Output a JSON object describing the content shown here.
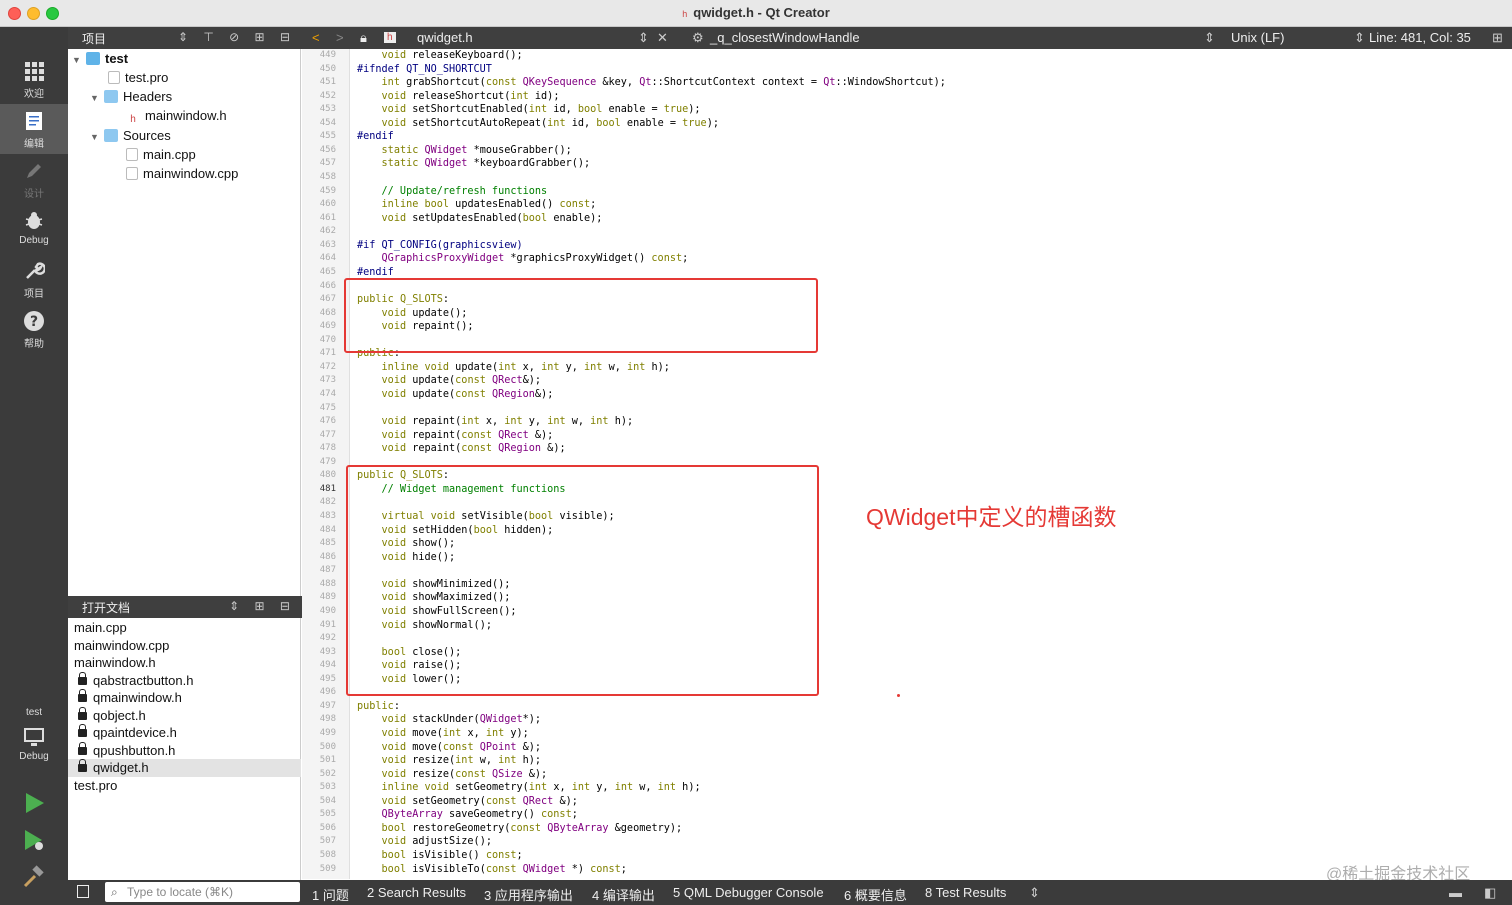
{
  "window": {
    "title": "qwidget.h - Qt Creator"
  },
  "modes": [
    {
      "label": "欢迎",
      "icon": "grid-icon"
    },
    {
      "label": "编辑",
      "icon": "edit-icon"
    },
    {
      "label": "设计",
      "icon": "pen-icon"
    },
    {
      "label": "Debug",
      "icon": "bug-icon"
    },
    {
      "label": "项目",
      "icon": "wrench-icon"
    },
    {
      "label": "帮助",
      "icon": "help-icon"
    }
  ],
  "kit": {
    "project": "test",
    "config": "Debug"
  },
  "project_pane": {
    "title": "项目",
    "tree": [
      {
        "label": "test",
        "level": 0,
        "bold": true
      },
      {
        "label": "test.pro",
        "level": 1
      },
      {
        "label": "Headers",
        "level": 1
      },
      {
        "label": "mainwindow.h",
        "level": 2
      },
      {
        "label": "Sources",
        "level": 1
      },
      {
        "label": "main.cpp",
        "level": 2
      },
      {
        "label": "mainwindow.cpp",
        "level": 2
      }
    ]
  },
  "open_docs": {
    "title": "打开文档",
    "items": [
      {
        "label": "main.cpp",
        "locked": false
      },
      {
        "label": "mainwindow.cpp",
        "locked": false
      },
      {
        "label": "mainwindow.h",
        "locked": false
      },
      {
        "label": "qabstractbutton.h",
        "locked": true
      },
      {
        "label": "qmainwindow.h",
        "locked": true
      },
      {
        "label": "qobject.h",
        "locked": true
      },
      {
        "label": "qpaintdevice.h",
        "locked": true
      },
      {
        "label": "qpushbutton.h",
        "locked": true
      },
      {
        "label": "qwidget.h",
        "locked": true
      },
      {
        "label": "test.pro",
        "locked": false
      }
    ]
  },
  "editor_toolbar": {
    "file": "qwidget.h",
    "symbol": "_q_closestWindowHandle",
    "line_ending": "Unix (LF)",
    "position": "Line: 481, Col: 35"
  },
  "editor": {
    "current_line": "481",
    "lines": [
      {
        "n": "449",
        "c": "    void releaseKeyboard();"
      },
      {
        "n": "450",
        "c": "#ifndef QT_NO_SHORTCUT"
      },
      {
        "n": "451",
        "c": "    int grabShortcut(const QKeySequence &key, Qt::ShortcutContext context = Qt::WindowShortcut);"
      },
      {
        "n": "452",
        "c": "    void releaseShortcut(int id);"
      },
      {
        "n": "453",
        "c": "    void setShortcutEnabled(int id, bool enable = true);"
      },
      {
        "n": "454",
        "c": "    void setShortcutAutoRepeat(int id, bool enable = true);"
      },
      {
        "n": "455",
        "c": "#endif"
      },
      {
        "n": "456",
        "c": "    static QWidget *mouseGrabber();"
      },
      {
        "n": "457",
        "c": "    static QWidget *keyboardGrabber();"
      },
      {
        "n": "458",
        "c": ""
      },
      {
        "n": "459",
        "c": "    // Update/refresh functions"
      },
      {
        "n": "460",
        "c": "    inline bool updatesEnabled() const;"
      },
      {
        "n": "461",
        "c": "    void setUpdatesEnabled(bool enable);"
      },
      {
        "n": "462",
        "c": ""
      },
      {
        "n": "463",
        "c": "#if QT_CONFIG(graphicsview)"
      },
      {
        "n": "464",
        "c": "    QGraphicsProxyWidget *graphicsProxyWidget() const;"
      },
      {
        "n": "465",
        "c": "#endif"
      },
      {
        "n": "466",
        "c": ""
      },
      {
        "n": "467",
        "c": "public Q_SLOTS:"
      },
      {
        "n": "468",
        "c": "    void update();"
      },
      {
        "n": "469",
        "c": "    void repaint();"
      },
      {
        "n": "470",
        "c": ""
      },
      {
        "n": "471",
        "c": "public:"
      },
      {
        "n": "472",
        "c": "    inline void update(int x, int y, int w, int h);"
      },
      {
        "n": "473",
        "c": "    void update(const QRect&);"
      },
      {
        "n": "474",
        "c": "    void update(const QRegion&);"
      },
      {
        "n": "475",
        "c": ""
      },
      {
        "n": "476",
        "c": "    void repaint(int x, int y, int w, int h);"
      },
      {
        "n": "477",
        "c": "    void repaint(const QRect &);"
      },
      {
        "n": "478",
        "c": "    void repaint(const QRegion &);"
      },
      {
        "n": "479",
        "c": ""
      },
      {
        "n": "480",
        "c": "public Q_SLOTS:"
      },
      {
        "n": "481",
        "c": "    // Widget management functions"
      },
      {
        "n": "482",
        "c": ""
      },
      {
        "n": "483",
        "c": "    virtual void setVisible(bool visible);"
      },
      {
        "n": "484",
        "c": "    void setHidden(bool hidden);"
      },
      {
        "n": "485",
        "c": "    void show();"
      },
      {
        "n": "486",
        "c": "    void hide();"
      },
      {
        "n": "487",
        "c": ""
      },
      {
        "n": "488",
        "c": "    void showMinimized();"
      },
      {
        "n": "489",
        "c": "    void showMaximized();"
      },
      {
        "n": "490",
        "c": "    void showFullScreen();"
      },
      {
        "n": "491",
        "c": "    void showNormal();"
      },
      {
        "n": "492",
        "c": ""
      },
      {
        "n": "493",
        "c": "    bool close();"
      },
      {
        "n": "494",
        "c": "    void raise();"
      },
      {
        "n": "495",
        "c": "    void lower();"
      },
      {
        "n": "496",
        "c": ""
      },
      {
        "n": "497",
        "c": "public:"
      },
      {
        "n": "498",
        "c": "    void stackUnder(QWidget*);"
      },
      {
        "n": "499",
        "c": "    void move(int x, int y);"
      },
      {
        "n": "500",
        "c": "    void move(const QPoint &);"
      },
      {
        "n": "501",
        "c": "    void resize(int w, int h);"
      },
      {
        "n": "502",
        "c": "    void resize(const QSize &);"
      },
      {
        "n": "503",
        "c": "    inline void setGeometry(int x, int y, int w, int h);"
      },
      {
        "n": "504",
        "c": "    void setGeometry(const QRect &);"
      },
      {
        "n": "505",
        "c": "    QByteArray saveGeometry() const;"
      },
      {
        "n": "506",
        "c": "    bool restoreGeometry(const QByteArray &geometry);"
      },
      {
        "n": "507",
        "c": "    void adjustSize();"
      },
      {
        "n": "508",
        "c": "    bool isVisible() const;"
      },
      {
        "n": "509",
        "c": "    bool isVisibleTo(const QWidget *) const;"
      }
    ]
  },
  "annotation": {
    "text": "QWidget中定义的槽函数",
    "color": "#e53935"
  },
  "watermark": "@稀土掘金技术社区",
  "status_bar": {
    "locate_placeholder": "Type to locate (⌘K)",
    "tabs": [
      "1 问题",
      "2 Search Results",
      "3 应用程序输出",
      "4 编译输出",
      "5 QML Debugger Console",
      "6 概要信息",
      "8 Test Results"
    ]
  }
}
